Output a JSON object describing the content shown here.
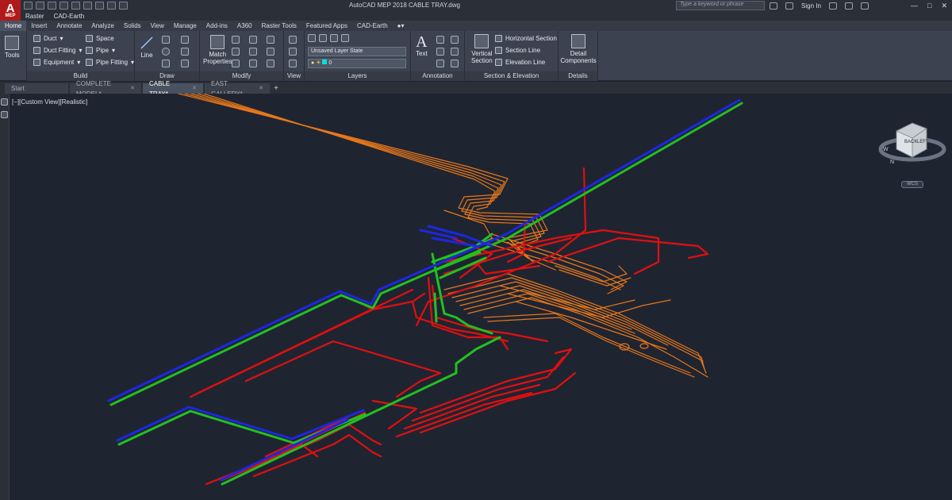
{
  "app": {
    "logo_text": "A",
    "logo_sub": "MEP",
    "window_title": "AutoCAD MEP 2018    CABLE TRAY.dwg"
  },
  "search": {
    "placeholder": "Type a keyword or phrase"
  },
  "account": {
    "sign_in": "Sign In"
  },
  "menu": [
    "Raster",
    "CAD-Earth"
  ],
  "ribbon_tabs": [
    "Home",
    "Insert",
    "Annotate",
    "Analyze",
    "Solids",
    "View",
    "Manage",
    "Add-ins",
    "A360",
    "Raster Tools",
    "Featured Apps",
    "CAD-Earth"
  ],
  "ribbon_active": "Home",
  "panels": {
    "tools": {
      "label": "Tools"
    },
    "build": {
      "title": "Build",
      "duct": "Duct",
      "duct_fitting": "Duct Fitting",
      "equipment": "Equipment",
      "space": "Space",
      "pipe": "Pipe",
      "pipe_fitting": "Pipe Fitting"
    },
    "draw": {
      "title": "Draw",
      "line": "Line"
    },
    "modify": {
      "title": "Modify",
      "match_1": "Match",
      "match_2": "Properties"
    },
    "view": {
      "title": "View"
    },
    "layers": {
      "title": "Layers",
      "layer_state": "Unsaved Layer State",
      "current_layer": "0"
    },
    "annotation": {
      "title": "Annotation",
      "text": "Text"
    },
    "section": {
      "title": "Section & Elevation",
      "vertical_1": "Vertical",
      "vertical_2": "Section",
      "horizontal": "Horizontal Section",
      "section_line": "Section Line",
      "elevation_line": "Elevation Line"
    },
    "details": {
      "title": "Details",
      "detail_1": "Detail",
      "detail_2": "Components"
    }
  },
  "file_tabs": [
    "Start",
    "COMPLETE MODEL*",
    "CABLE TRAY*",
    "EAST GALLERY*"
  ],
  "file_tab_active": "CABLE TRAY*",
  "viewport": {
    "label": "[−][Custom View][Realistic]"
  },
  "viewcube": {
    "face_back": "BACK",
    "face_left": "LEFT",
    "dir_w": "W",
    "dir_n": "N",
    "ucs": "WCS"
  },
  "colors": {
    "tray_orange": "#e8781a",
    "pipe_red": "#e01010",
    "green": "#22c020",
    "blue": "#1c28e0",
    "bg": "#1f2431"
  }
}
